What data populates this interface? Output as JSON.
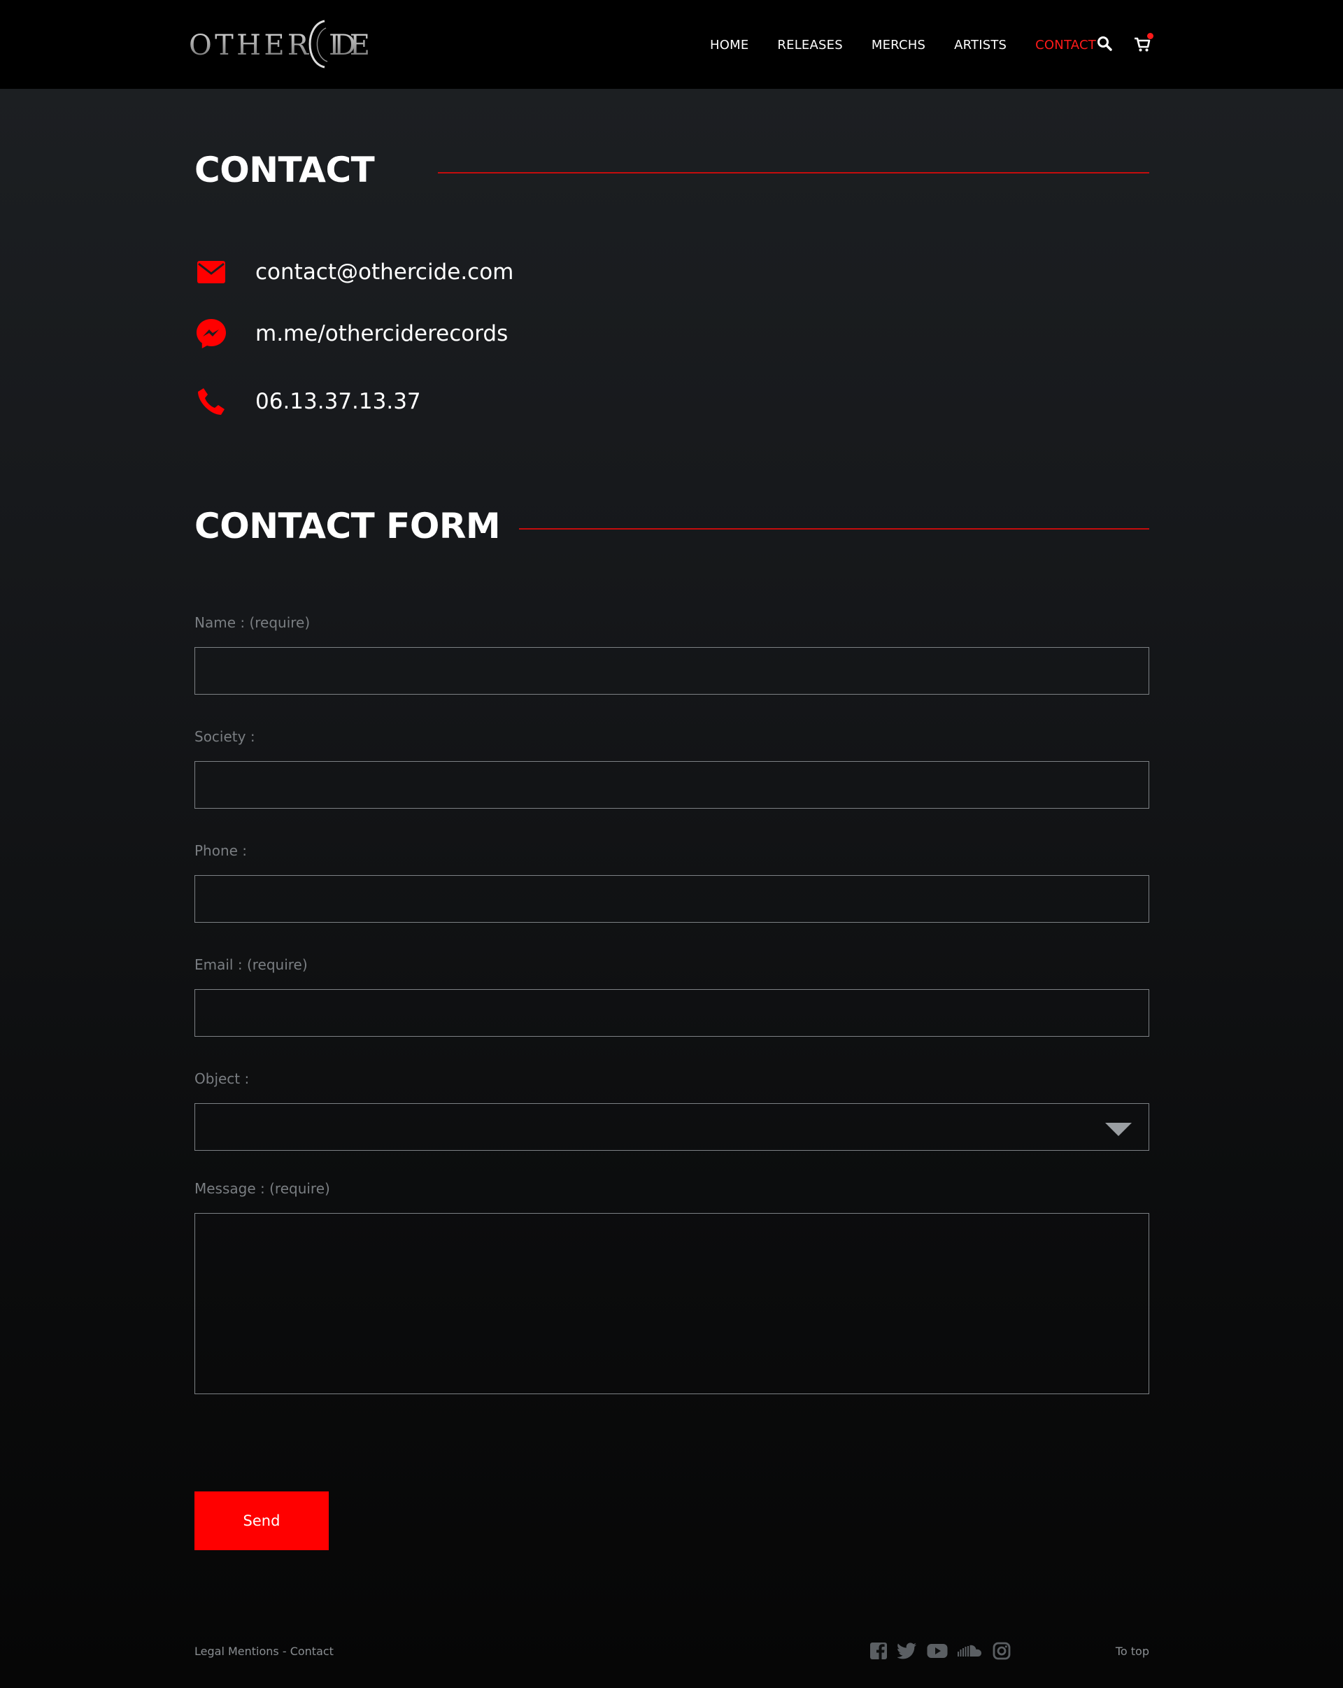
{
  "header": {
    "logo_text": "OTHERCIDE",
    "nav": [
      {
        "label": "HOME",
        "active": false
      },
      {
        "label": "RELEASES",
        "active": false
      },
      {
        "label": "MERCHS",
        "active": false
      },
      {
        "label": "ARTISTS",
        "active": false
      },
      {
        "label": "CONTACT",
        "active": true
      }
    ],
    "search_icon": "search-icon",
    "cart_icon": "cart-icon",
    "cart_badge": true
  },
  "contact": {
    "title": "CONTACT",
    "email": "contact@othercide.com",
    "messenger": "m.me/otherciderecords",
    "phone": "06.13.37.13.37"
  },
  "form": {
    "title": "CONTACT FORM",
    "name_label": "Name : (require)",
    "name_value": "",
    "society_label": "Society :",
    "society_value": "",
    "phone_label": "Phone :",
    "phone_value": "",
    "email_label": "Email : (require)",
    "email_value": "",
    "object_label": "Object :",
    "object_value": "",
    "message_label": "Message : (require)",
    "message_value": "",
    "send_label": "Send"
  },
  "footer": {
    "links": "Legal Mentions - Contact",
    "social_icons": [
      "facebook-icon",
      "twitter-icon",
      "youtube-icon",
      "soundcloud-icon",
      "instagram-icon"
    ],
    "to_top": "To top"
  },
  "colors": {
    "accent": "#ff0000",
    "rule": "#c40d0d",
    "background": "#1c1f22",
    "header": "#000000"
  }
}
